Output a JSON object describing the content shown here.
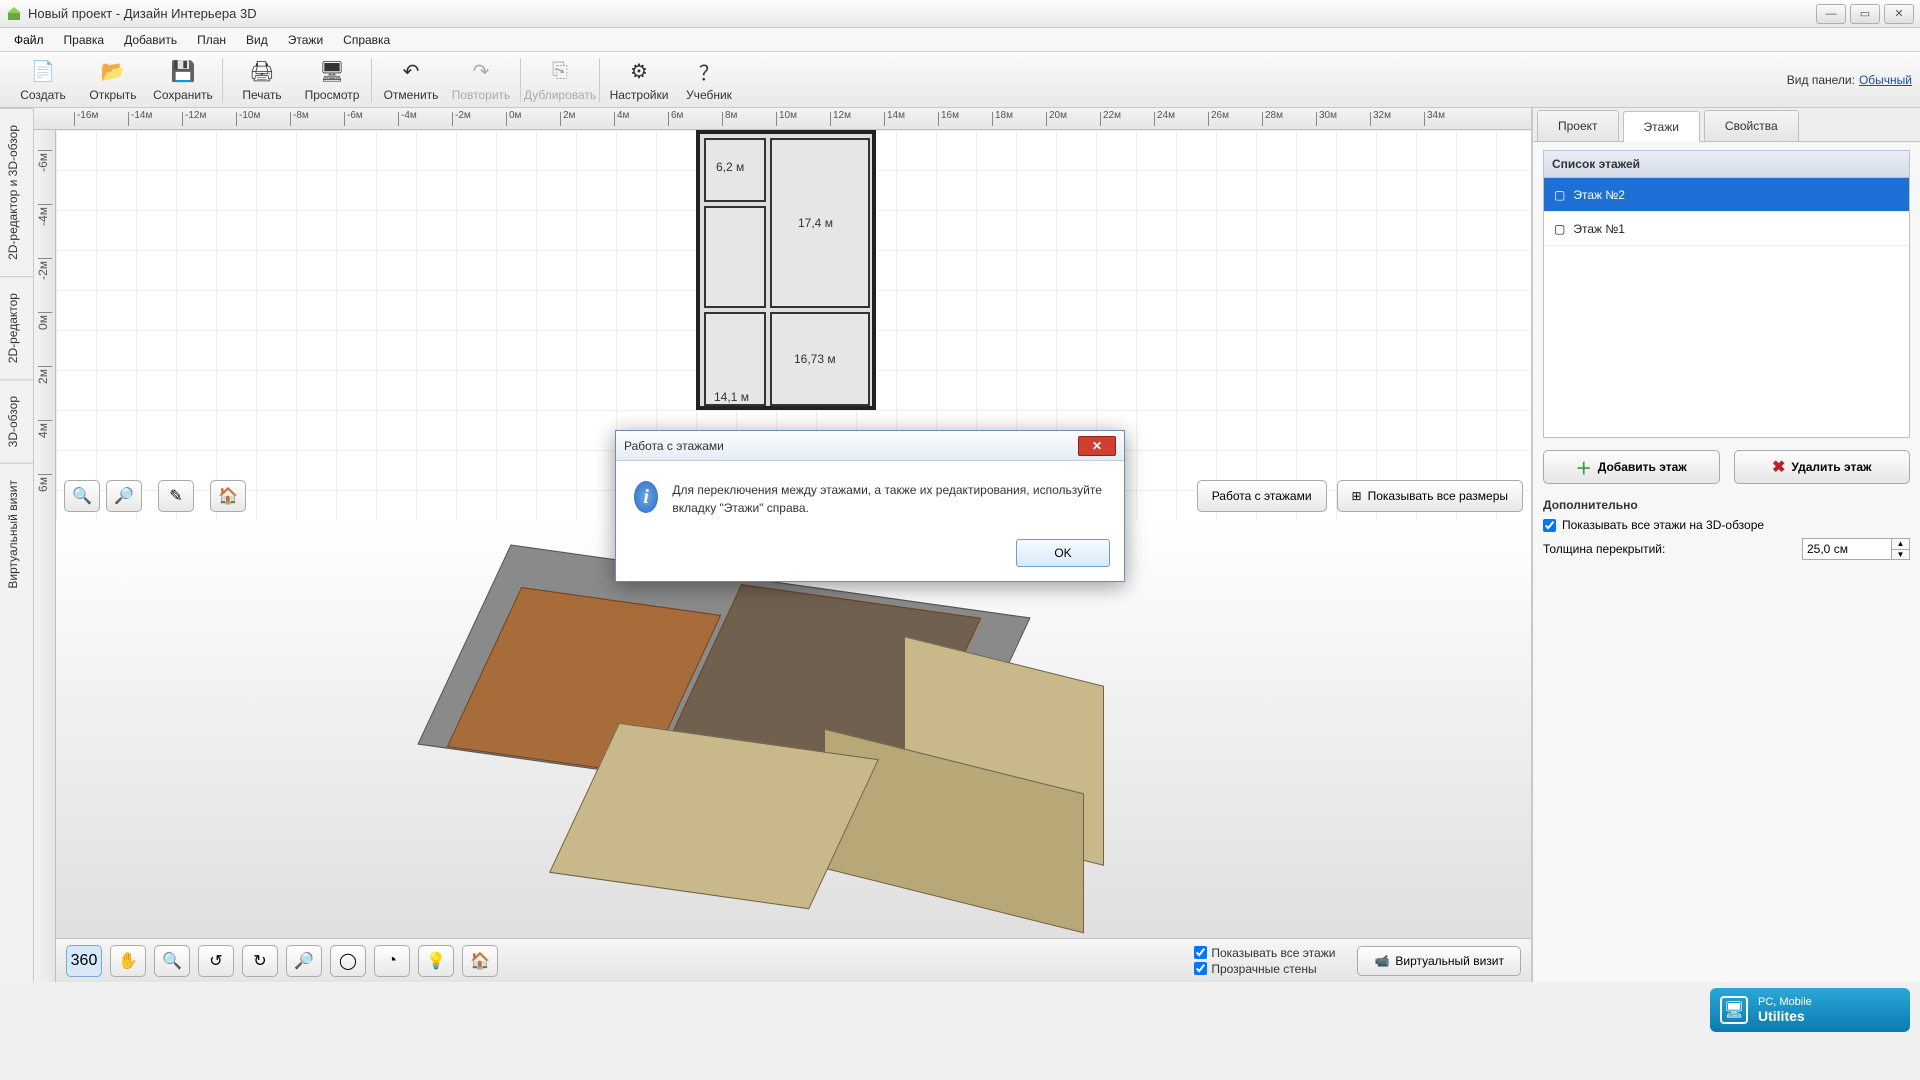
{
  "title": "Новый проект - Дизайн Интерьера 3D",
  "menu": [
    "Файл",
    "Правка",
    "Добавить",
    "План",
    "Вид",
    "Этажи",
    "Справка"
  ],
  "toolbar": [
    {
      "label": "Создать",
      "icon": "📄",
      "enabled": true,
      "name": "new"
    },
    {
      "label": "Открыть",
      "icon": "📂",
      "enabled": true,
      "name": "open"
    },
    {
      "label": "Сохранить",
      "icon": "💾",
      "enabled": true,
      "name": "save"
    },
    {
      "sep": true
    },
    {
      "label": "Печать",
      "icon": "🖨",
      "enabled": true,
      "name": "print"
    },
    {
      "label": "Просмотр",
      "icon": "🖥",
      "enabled": true,
      "name": "preview"
    },
    {
      "sep": true
    },
    {
      "label": "Отменить",
      "icon": "↶",
      "enabled": true,
      "name": "undo"
    },
    {
      "label": "Повторить",
      "icon": "↷",
      "enabled": false,
      "name": "redo"
    },
    {
      "sep": true
    },
    {
      "label": "Дублировать",
      "icon": "⎘",
      "enabled": false,
      "name": "duplicate"
    },
    {
      "sep": true
    },
    {
      "label": "Настройки",
      "icon": "⚙",
      "enabled": true,
      "name": "settings"
    },
    {
      "label": "Учебник",
      "icon": "？",
      "enabled": true,
      "name": "help"
    }
  ],
  "panelview_label": "Вид панели:",
  "panelview_value": "Обычный",
  "viewtabs": [
    "2D-редактор и 3D-обзор",
    "2D-редактор",
    "3D-обзор",
    "Виртуальный визит"
  ],
  "ruler_h": [
    "-16м",
    "-14м",
    "-12м",
    "-10м",
    "-8м",
    "-6м",
    "-4м",
    "-2м",
    "0м",
    "2м",
    "4м",
    "6м",
    "8м",
    "10м",
    "12м",
    "14м",
    "16м",
    "18м",
    "20м",
    "22м",
    "24м",
    "26м",
    "28м",
    "30м",
    "32м",
    "34м"
  ],
  "ruler_v": [
    "-6м",
    "-4м",
    "-2м",
    "0м",
    "2м",
    "4м",
    "6м"
  ],
  "floorplan_labels": {
    "r1": "6,2 м",
    "r2": "17,4 м",
    "r3": "14,1 м",
    "r4": "16,73 м"
  },
  "canvas2d_btns_right": [
    {
      "label": "Работа с этажами",
      "name": "floors-work"
    },
    {
      "label": "Показывать все размеры",
      "icon": "⊞",
      "name": "show-all-dims"
    }
  ],
  "canvas3d_checks": [
    {
      "label": "Показывать все этажи",
      "checked": true,
      "name": "show-all-floors"
    },
    {
      "label": "Прозрачные стены",
      "checked": true,
      "name": "transparent-walls"
    }
  ],
  "virtual_visit_btn": "Виртуальный визит",
  "side_tabs": [
    "Проект",
    "Этажи",
    "Свойства"
  ],
  "side_active_tab": 1,
  "floors_heading": "Список этажей",
  "floors": [
    {
      "label": "Этаж №2",
      "selected": true
    },
    {
      "label": "Этаж №1",
      "selected": false
    }
  ],
  "add_floor": "Добавить этаж",
  "del_floor": "Удалить этаж",
  "extra_heading": "Дополнительно",
  "show3d_check": "Показывать все этажи на 3D-обзоре",
  "slab_label": "Толщина перекрытий:",
  "slab_value": "25,0 см",
  "dialog": {
    "title": "Работа с этажами",
    "message": "Для переключения между этажами, а также их редактирования, используйте вкладку \"Этажи\" справа.",
    "ok": "OK"
  },
  "watermark": {
    "line1": "PC, Mobile",
    "line2": "Utilites"
  }
}
